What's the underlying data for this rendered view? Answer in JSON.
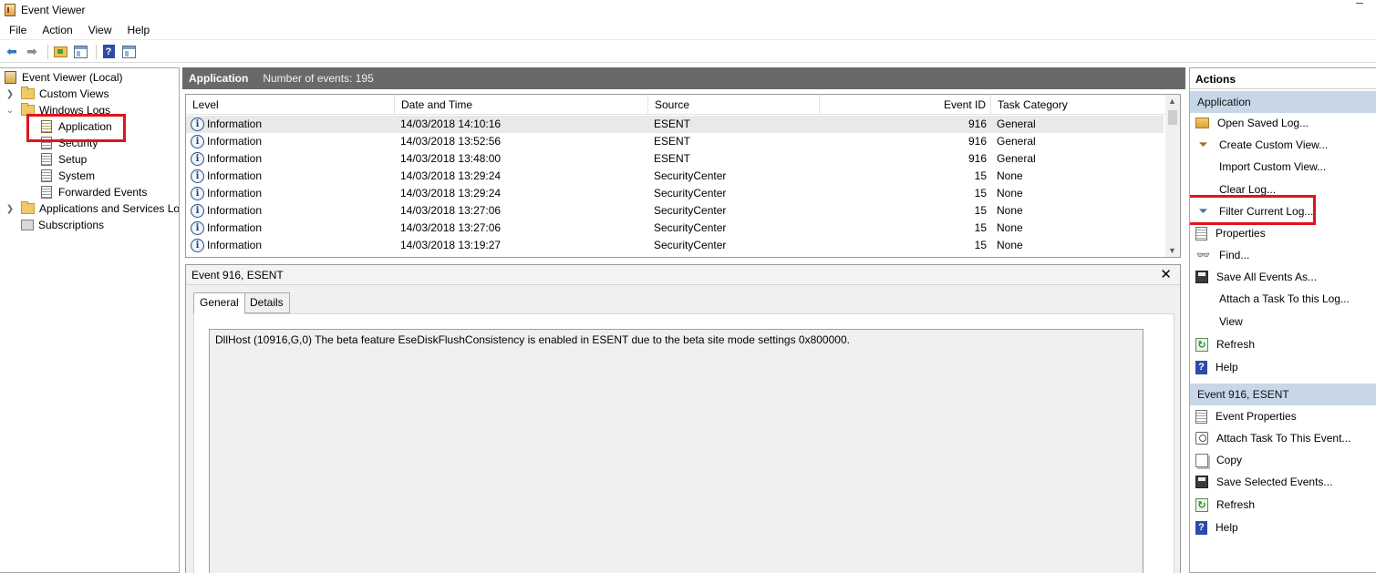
{
  "window": {
    "title": "Event Viewer"
  },
  "menu": [
    "File",
    "Action",
    "View",
    "Help"
  ],
  "toolbar": {
    "icons": [
      "back-arrow-icon",
      "forward-arrow-icon",
      "open-folder-icon",
      "show-hide-console-tree-icon",
      "help-icon",
      "show-hide-action-pane-icon"
    ]
  },
  "tree": {
    "root": "Event Viewer (Local)",
    "custom_views": "Custom Views",
    "windows_logs": "Windows Logs",
    "application": "Application",
    "security": "Security",
    "setup": "Setup",
    "system": "System",
    "forwarded_events": "Forwarded Events",
    "apps_services": "Applications and Services Lo",
    "subscriptions": "Subscriptions"
  },
  "center": {
    "title": "Application",
    "count_text": "Number of events: 195"
  },
  "grid": {
    "columns": [
      "Level",
      "Date and Time",
      "Source",
      "Event ID",
      "Task Category"
    ],
    "rows": [
      {
        "level": "Information",
        "date": "14/03/2018 14:10:16",
        "source": "ESENT",
        "event_id": "916",
        "category": "General"
      },
      {
        "level": "Information",
        "date": "14/03/2018 13:52:56",
        "source": "ESENT",
        "event_id": "916",
        "category": "General"
      },
      {
        "level": "Information",
        "date": "14/03/2018 13:48:00",
        "source": "ESENT",
        "event_id": "916",
        "category": "General"
      },
      {
        "level": "Information",
        "date": "14/03/2018 13:29:24",
        "source": "SecurityCenter",
        "event_id": "15",
        "category": "None"
      },
      {
        "level": "Information",
        "date": "14/03/2018 13:29:24",
        "source": "SecurityCenter",
        "event_id": "15",
        "category": "None"
      },
      {
        "level": "Information",
        "date": "14/03/2018 13:27:06",
        "source": "SecurityCenter",
        "event_id": "15",
        "category": "None"
      },
      {
        "level": "Information",
        "date": "14/03/2018 13:27:06",
        "source": "SecurityCenter",
        "event_id": "15",
        "category": "None"
      },
      {
        "level": "Information",
        "date": "14/03/2018 13:19:27",
        "source": "SecurityCenter",
        "event_id": "15",
        "category": "None"
      }
    ]
  },
  "detail": {
    "title": "Event 916, ESENT",
    "tabs": [
      "General",
      "Details"
    ],
    "message": "DllHost (10916,G,0) The beta feature EseDiskFlushConsistency is enabled in ESENT due to the beta site mode settings 0x800000."
  },
  "actions": {
    "title": "Actions",
    "section_application": "Application",
    "application_items": [
      {
        "label": "Open Saved Log...",
        "icon": "open-folder-icon"
      },
      {
        "label": "Create Custom View...",
        "icon": "funnel-icon"
      },
      {
        "label": "Import Custom View...",
        "icon": ""
      },
      {
        "label": "Clear Log...",
        "icon": ""
      },
      {
        "label": "Filter Current Log...",
        "icon": "filter-icon"
      },
      {
        "label": "Properties",
        "icon": "properties-icon"
      },
      {
        "label": "Find...",
        "icon": "binoculars-icon"
      },
      {
        "label": "Save All Events As...",
        "icon": "save-icon"
      },
      {
        "label": "Attach a Task To this Log...",
        "icon": ""
      },
      {
        "label": "View",
        "icon": ""
      },
      {
        "label": "Refresh",
        "icon": "refresh-icon"
      },
      {
        "label": "Help",
        "icon": "help-icon"
      }
    ],
    "section_event": "Event 916, ESENT",
    "event_items": [
      {
        "label": "Event Properties",
        "icon": "properties-icon"
      },
      {
        "label": "Attach Task To This Event...",
        "icon": "task-icon"
      },
      {
        "label": "Copy",
        "icon": "copy-icon"
      },
      {
        "label": "Save Selected Events...",
        "icon": "save-icon"
      },
      {
        "label": "Refresh",
        "icon": "refresh-icon"
      },
      {
        "label": "Help",
        "icon": "help-icon"
      }
    ]
  },
  "colors": {
    "highlight": "#e0141e",
    "center_header": "#696969",
    "section_header": "#c8d7e8"
  }
}
